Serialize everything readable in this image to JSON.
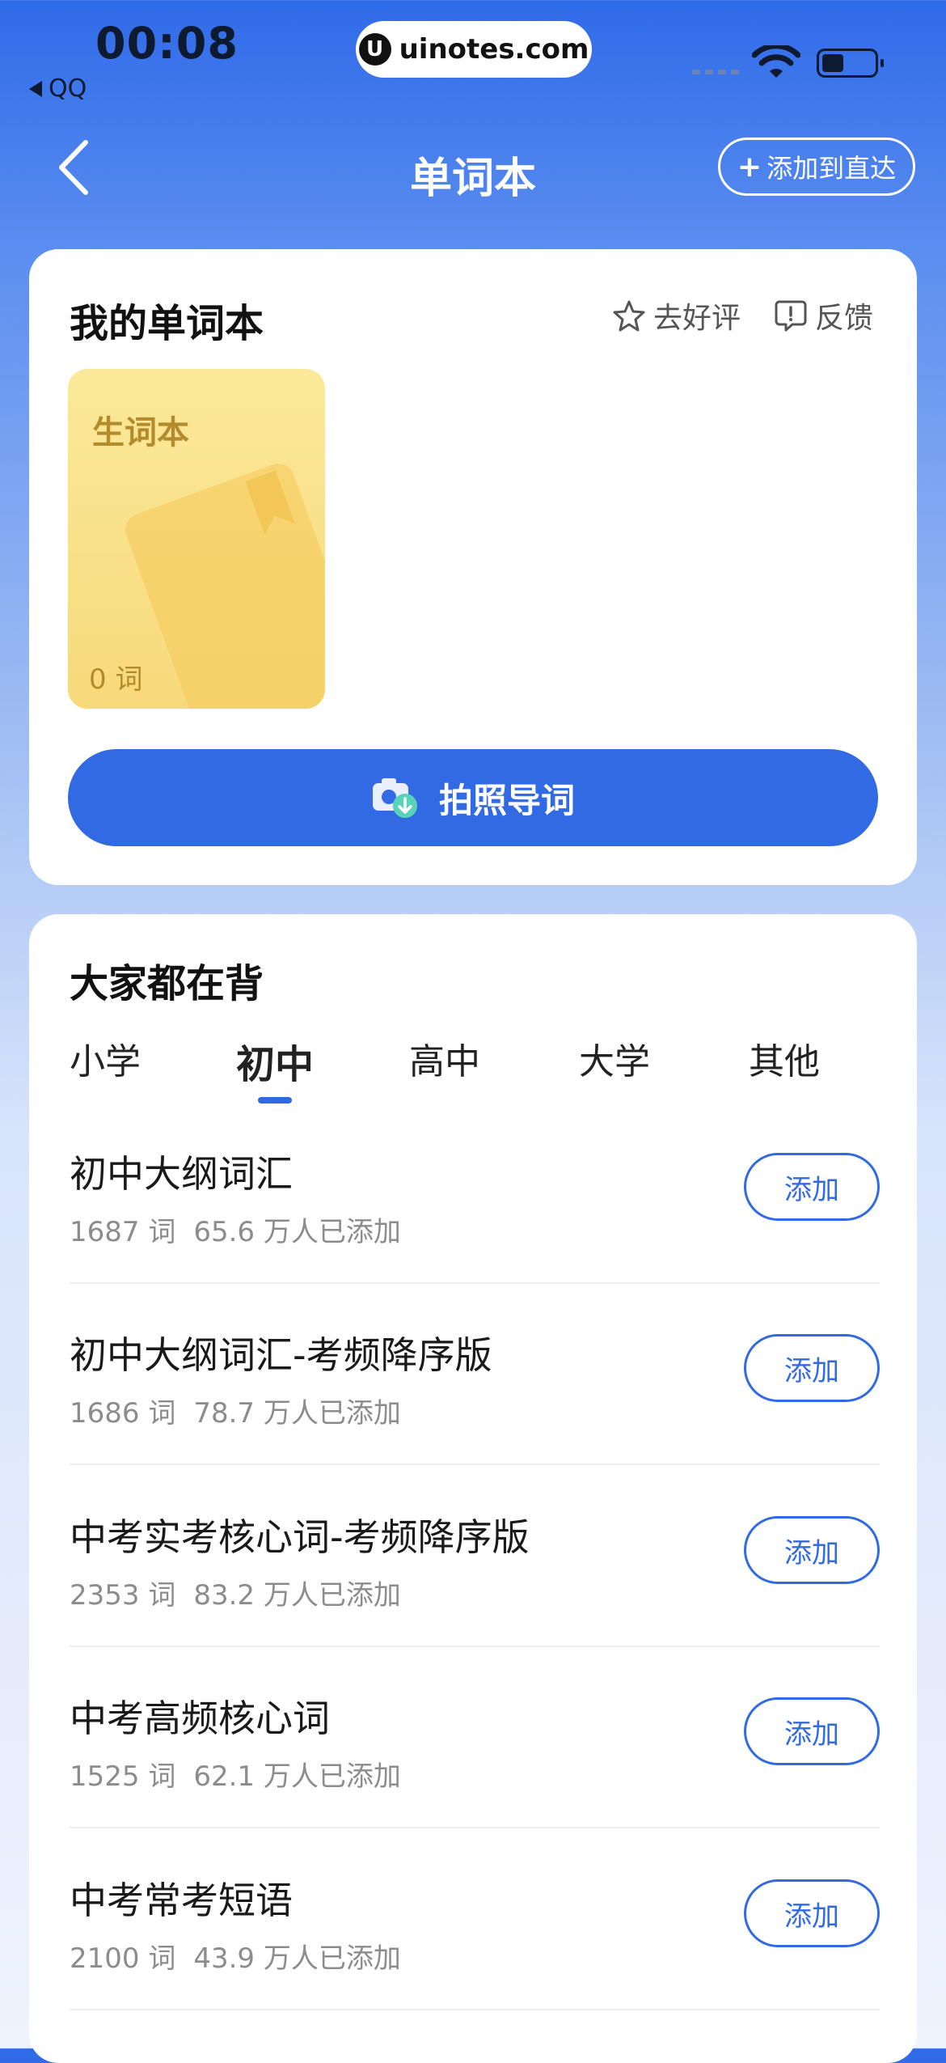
{
  "status_bar": {
    "time": "00:08",
    "back_app": "QQ",
    "url": "uinotes.com",
    "url_logo": "U"
  },
  "nav": {
    "title": "单词本",
    "add_direct_label": "添加到直达"
  },
  "my_wordbooks": {
    "title": "我的单词本",
    "rate_label": "去好评",
    "feedback_label": "反馈",
    "books": [
      {
        "name": "生词本",
        "count": "0 词"
      }
    ],
    "photo_import_label": "拍照导词"
  },
  "popular": {
    "title": "大家都在背",
    "tabs": [
      "小学",
      "初中",
      "高中",
      "大学",
      "其他"
    ],
    "active_tab": "初中",
    "add_label": "添加",
    "lists": [
      {
        "title": "初中大纲词汇",
        "words": "1687 词",
        "added": "65.6 万人已添加"
      },
      {
        "title": "初中大纲词汇-考频降序版",
        "words": "1686 词",
        "added": "78.7 万人已添加"
      },
      {
        "title": "中考实考核心词-考频降序版",
        "words": "2353 词",
        "added": "83.2 万人已添加"
      },
      {
        "title": "中考高频核心词",
        "words": "1525 词",
        "added": "62.1 万人已添加"
      },
      {
        "title": "中考常考短语",
        "words": "2100 词",
        "added": "43.9 万人已添加"
      }
    ]
  },
  "colors": {
    "accent": "#326ae3",
    "header_gradient_top": "#2f6ae8",
    "wordbook_bg": "#f7d97a"
  }
}
